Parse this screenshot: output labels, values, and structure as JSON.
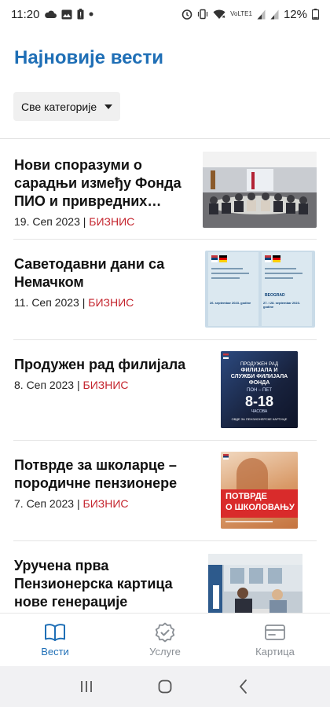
{
  "status_bar": {
    "time": "11:20",
    "left_icons": [
      "cloud-icon",
      "image-icon",
      "battery-alert-icon",
      "dot-icon"
    ],
    "right_icons": [
      "alarm-icon",
      "vibrate-icon",
      "wifi-icon",
      "volte-icon",
      "signal-icon",
      "signal-icon"
    ],
    "volte_label": "VoLTE1",
    "battery": "12%"
  },
  "header": {
    "title": "Најновије вести",
    "category_select": {
      "selected": "Све категорије",
      "icon": "caret-down-icon"
    }
  },
  "news": [
    {
      "title": "Нови споразуми о сарадњи између Фонда ПИО и привредних субј...",
      "date": "19. Сеп 2023",
      "separator": "|",
      "category": "БИЗНИС",
      "thumb": "meeting-photo"
    },
    {
      "title": "Саветодавни дани са Немачком",
      "date": "11. Сеп 2023",
      "separator": "|",
      "category": "БИЗНИС",
      "thumb": "flyer-serbia-germany"
    },
    {
      "title": "Продужен рад филијала",
      "date": "8. Сеп 2023",
      "separator": "|",
      "category": "БИЗНИС",
      "thumb": "poster-branch-hours"
    },
    {
      "title": "Потврде за школарце – породичне пензионере",
      "date": "7. Сеп 2023",
      "separator": "|",
      "category": "БИЗНИС",
      "thumb": "poster-school-certificates"
    },
    {
      "title": "Уручена прва Пензионерска картица нове генерације",
      "date": "",
      "separator": "",
      "category": "",
      "thumb": "photo-card-handover"
    }
  ],
  "thumbs": {
    "flyer_left_date": "26. septembar 2023. godine",
    "flyer_right_city": "BEOGRAD",
    "flyer_right_date": "27. i 28. septembar 2023. godine",
    "poster_line1": "ПРОДУЖЕН РАД",
    "poster_line2": "ФИЛИЈАЛА И",
    "poster_line3": "СЛУЖБИ ФИЛИЈАЛА",
    "poster_line4": "ФОНДА",
    "poster_days": "ПОН – ПЕТ",
    "poster_hours": "8-18",
    "poster_hours_sub": "ЧАСОВА",
    "poster_footer": "ОВДЕ ЗА ПЕНЗИОНЕРСКЕ КАРТИЦЕ",
    "school_line1": "ПОТВРДЕ",
    "school_line2": "О ШКОЛОВАЊУ"
  },
  "bottom_nav": [
    {
      "label": "Вести",
      "icon": "book-icon",
      "active": true
    },
    {
      "label": "Услуге",
      "icon": "badge-check-icon",
      "active": false
    },
    {
      "label": "Картица",
      "icon": "card-icon",
      "active": false
    }
  ],
  "system_nav": [
    "recent-apps-icon",
    "home-icon",
    "back-icon"
  ],
  "colors": {
    "accent": "#1f6fb6",
    "category": "#c4242d",
    "inactive": "#8a8f95"
  }
}
